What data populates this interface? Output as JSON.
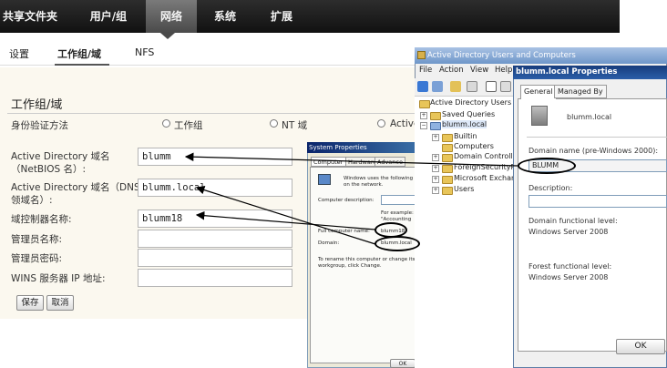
{
  "nav": {
    "tabs": [
      "共享文件夹",
      "用户/组",
      "网络",
      "系统",
      "扩展"
    ],
    "active": "网络"
  },
  "subnav": {
    "items": [
      "设置",
      "工作组/域",
      "NFS"
    ],
    "active": "工作组/域"
  },
  "page": {
    "title": "工作组/域",
    "auth_label": "身份验证方法",
    "auth_options": [
      "工作组",
      "NT 域",
      "Active"
    ],
    "fields": [
      {
        "label": "Active Directory 域名",
        "sublabel": "（NetBIOS 名）:",
        "value": "blumm"
      },
      {
        "label": "Active Directory 域名（DNS/",
        "sublabel": "领域名）:",
        "value": "blumm.local"
      },
      {
        "label": "域控制器名称:",
        "sublabel": "",
        "value": "blumm18"
      },
      {
        "label": "管理员名称:",
        "sublabel": "",
        "value": ""
      },
      {
        "label": "管理员密码:",
        "sublabel": "",
        "value": ""
      },
      {
        "label": "WINS 服务器 IP 地址:",
        "sublabel": "",
        "value": ""
      }
    ],
    "save_label": "保存",
    "cancel_label": "取消"
  },
  "system_properties": {
    "title": "System Properties",
    "tabs": [
      "Computer Name",
      "Hardware",
      "Advance"
    ],
    "intro": "Windows uses the following",
    "intro2": "on the network.",
    "computer_description_label": "Computer description:",
    "example": "For example:",
    "example2": "\"Accounting",
    "full_name_label": "Full computer name:",
    "full_name_value": "blumm18.",
    "domain_label": "Domain:",
    "domain_value": "blumm.local",
    "rename_text": "To rename this computer or change its",
    "rename_text2": "workgroup, click Change.",
    "ok_label": "OK"
  },
  "aduc": {
    "title": "Active Directory Users and Computers",
    "menu": [
      "File",
      "Action",
      "View",
      "Help"
    ],
    "tree": [
      "Active Directory Users and",
      "Saved Queries",
      "blumm.local",
      "Builtin",
      "Computers",
      "Domain Controllers",
      "ForeignSecurityPrin",
      "Microsoft Exchang",
      "Users"
    ]
  },
  "domain_props": {
    "title": "blumm.local Properties",
    "tabs": [
      "General",
      "Managed By"
    ],
    "domain_name": "blumm.local",
    "prewin_label": "Domain name (pre-Windows 2000):",
    "prewin_value": "BLUMM",
    "description_label": "Description:",
    "description_value": "",
    "domain_level_label": "Domain functional level:",
    "domain_level_value": "Windows Server 2008",
    "forest_level_label": "Forest functional level:",
    "forest_level_value": "Windows Server 2008",
    "ok_label": "OK"
  }
}
